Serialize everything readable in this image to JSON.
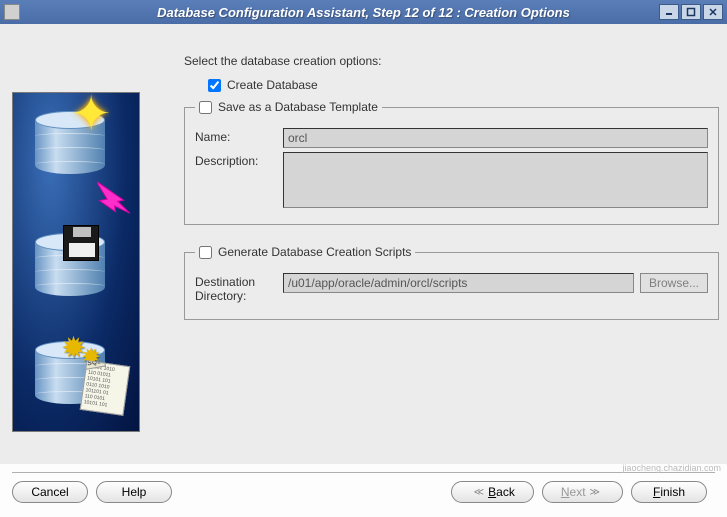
{
  "window": {
    "title": "Database Configuration Assistant, Step 12 of 12 : Creation Options"
  },
  "prompt": "Select the database creation options:",
  "options": {
    "create_db": {
      "label": "Create Database",
      "checked": true
    },
    "save_template": {
      "legend": "Save as a Database Template",
      "checked": false,
      "name_label": "Name:",
      "name_value": "orcl",
      "description_label": "Description:",
      "description_value": ""
    },
    "gen_scripts": {
      "legend": "Generate Database Creation Scripts",
      "checked": false,
      "dest_label": "Destination Directory:",
      "dest_value": "/u01/app/oracle/admin/orcl/scripts",
      "browse_label": "Browse..."
    }
  },
  "buttons": {
    "cancel": "Cancel",
    "help": "Help",
    "back": "Back",
    "next": "Next",
    "finish": "Finish"
  },
  "watermark": "jiaocheng.chazidian.com"
}
